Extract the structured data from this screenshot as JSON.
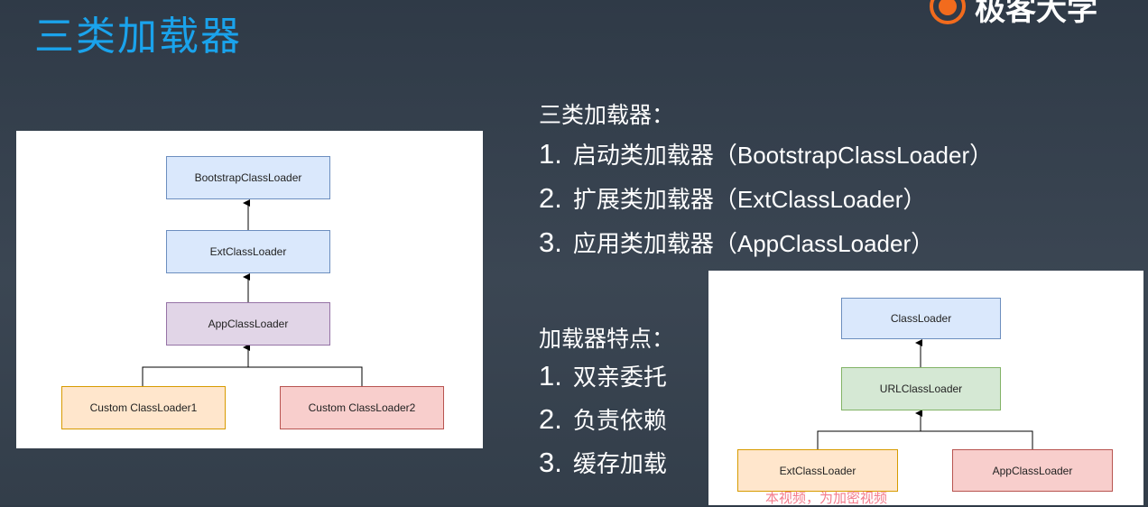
{
  "title": "三类加载器",
  "logo": {
    "text": "极客大学",
    "color": "#f26b1d"
  },
  "left_diagram": {
    "nodes": {
      "bootstrap": "BootstrapClassLoader",
      "ext": "ExtClassLoader",
      "app": "AppClassLoader",
      "custom1": "Custom ClassLoader1",
      "custom2": "Custom ClassLoader2"
    }
  },
  "right_diagram": {
    "nodes": {
      "classloader": "ClassLoader",
      "urlclassloader": "URLClassLoader",
      "ext": "ExtClassLoader",
      "app": "AppClassLoader"
    }
  },
  "loaders_heading": "三类加载器：",
  "loaders": [
    {
      "num": "1.",
      "cn": "启动类加载器（",
      "en": "BootstrapClassLoader",
      "close": "）"
    },
    {
      "num": "2.",
      "cn": "扩展类加载器（",
      "en": "ExtClassLoader",
      "close": "）"
    },
    {
      "num": "3.",
      "cn": "应用类加载器（",
      "en": "AppClassLoader",
      "close": "）"
    }
  ],
  "features_heading": "加载器特点：",
  "features": [
    {
      "num": "1.",
      "text": "双亲委托"
    },
    {
      "num": "2.",
      "text": "负责依赖"
    },
    {
      "num": "3.",
      "text": "缓存加载"
    }
  ],
  "watermark": "本视频，为加密视频"
}
